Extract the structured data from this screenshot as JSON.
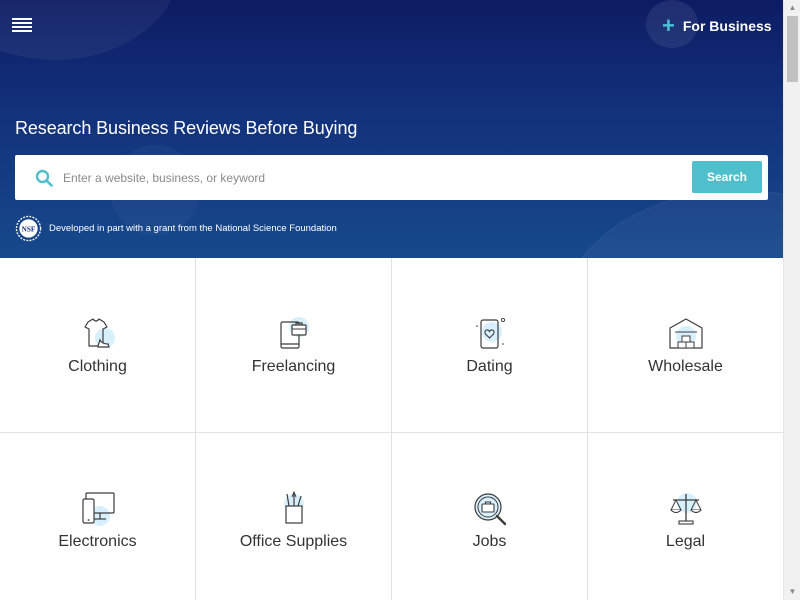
{
  "header": {
    "menu_icon": "hamburger-menu-icon",
    "for_business_label": "For Business",
    "plus_symbol": "+"
  },
  "hero": {
    "title": "Research Business Reviews Before Buying",
    "search": {
      "placeholder": "Enter a website, business, or keyword",
      "value": "",
      "button_label": "Search"
    },
    "nsf": {
      "logo_text": "NSF",
      "text": "Developed in part with a grant from the National Science Foundation"
    }
  },
  "categories": [
    {
      "label": "Clothing",
      "icon": "clothing-icon"
    },
    {
      "label": "Freelancing",
      "icon": "freelancing-icon"
    },
    {
      "label": "Dating",
      "icon": "dating-icon"
    },
    {
      "label": "Wholesale",
      "icon": "wholesale-icon"
    },
    {
      "label": "Electronics",
      "icon": "electronics-icon"
    },
    {
      "label": "Office Supplies",
      "icon": "office-supplies-icon"
    },
    {
      "label": "Jobs",
      "icon": "jobs-icon"
    },
    {
      "label": "Legal",
      "icon": "legal-icon"
    }
  ],
  "colors": {
    "hero_top": "#0d1c63",
    "hero_bottom": "#17498c",
    "accent": "#4fbfcc",
    "icon_blob": "#d8f0fb"
  }
}
